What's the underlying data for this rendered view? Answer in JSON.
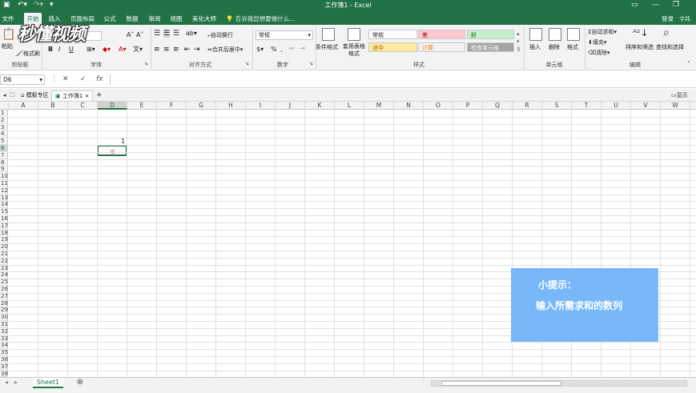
{
  "window": {
    "title": "工作簿1 - Excel",
    "login_label": "登录",
    "share_label": "共享"
  },
  "tabs": [
    {
      "label": "文件",
      "active": false
    },
    {
      "label": "开始",
      "active": true
    },
    {
      "label": "插入",
      "active": false
    },
    {
      "label": "页面布局",
      "active": false
    },
    {
      "label": "公式",
      "active": false
    },
    {
      "label": "数据",
      "active": false
    },
    {
      "label": "审阅",
      "active": false
    },
    {
      "label": "视图",
      "active": false
    },
    {
      "label": "美化大师",
      "active": false
    }
  ],
  "tell_me": "告诉我您想要做什么...",
  "ribbon": {
    "clipboard": {
      "paste": "粘贴",
      "format_painter": "格式刷",
      "label": "剪贴板"
    },
    "font": {
      "label": "字体",
      "bold": "B",
      "italic": "I",
      "underline": "U"
    },
    "alignment": {
      "wrap_text": "自动换行",
      "merge_center": "合并后居中",
      "label": "对齐方式"
    },
    "number": {
      "format_value": "常规",
      "label": "数字"
    },
    "styles": {
      "conditional_format": "条件格式",
      "format_table": "套用表格格式",
      "label": "样式",
      "cells": [
        {
          "text": "常规",
          "bg": "#ffffff",
          "color": "#222222"
        },
        {
          "text": "差",
          "bg": "#ffc7ce",
          "color": "#9c0006"
        },
        {
          "text": "好",
          "bg": "#c6efce",
          "color": "#006100"
        },
        {
          "text": "适中",
          "bg": "#ffeb9c",
          "color": "#9c6500"
        },
        {
          "text": "计算",
          "bg": "#f2f2f2",
          "color": "#fa7d00"
        },
        {
          "text": "检查单元格",
          "bg": "#a5a5a5",
          "color": "#ffffff"
        }
      ]
    },
    "cells_group": {
      "insert": "插入",
      "delete": "删除",
      "format": "格式",
      "label": "单元格"
    },
    "editing": {
      "autosum": "自动求和",
      "fill": "填充",
      "clear": "清除",
      "sort_filter": "排序和筛选",
      "find_select": "查找和选择",
      "label": "编辑"
    }
  },
  "logo_text": "秒懂视频",
  "formula_bar": {
    "name_box": "D6",
    "cancel_icon": "✕",
    "enter_icon": "✓",
    "fx_label": "fx",
    "value": ""
  },
  "doc_tabs": [
    {
      "label": "模板专区",
      "active": false
    },
    {
      "label": "工作簿1",
      "active": true
    }
  ],
  "doc_tabs_right": "显示多窗",
  "columns": [
    "A",
    "B",
    "C",
    "D",
    "E",
    "F",
    "G",
    "H",
    "I",
    "J",
    "K",
    "L",
    "M",
    "N",
    "O",
    "P",
    "Q",
    "R",
    "S",
    "T",
    "U",
    "V",
    "W"
  ],
  "rows": [
    "1",
    "2",
    "3",
    "4",
    "5",
    "6",
    "7",
    "8",
    "9",
    "10",
    "11",
    "12",
    "13",
    "14",
    "15",
    "16",
    "17",
    "18",
    "19",
    "20",
    "21",
    "22",
    "23",
    "24",
    "25",
    "26",
    "27",
    "28",
    "29",
    "30",
    "31",
    "32",
    "33",
    "34",
    "35",
    "36",
    "37",
    "38"
  ],
  "selected_column": "D",
  "selected_row": "6",
  "cells": {
    "D5": "1"
  },
  "tip": {
    "heading": "小提示：",
    "body": "输入所需求和的数列"
  },
  "sheets": [
    {
      "label": "Sheet1",
      "active": true
    }
  ],
  "colors": {
    "accent": "#217346",
    "tip_bg": "#78b8f8"
  }
}
